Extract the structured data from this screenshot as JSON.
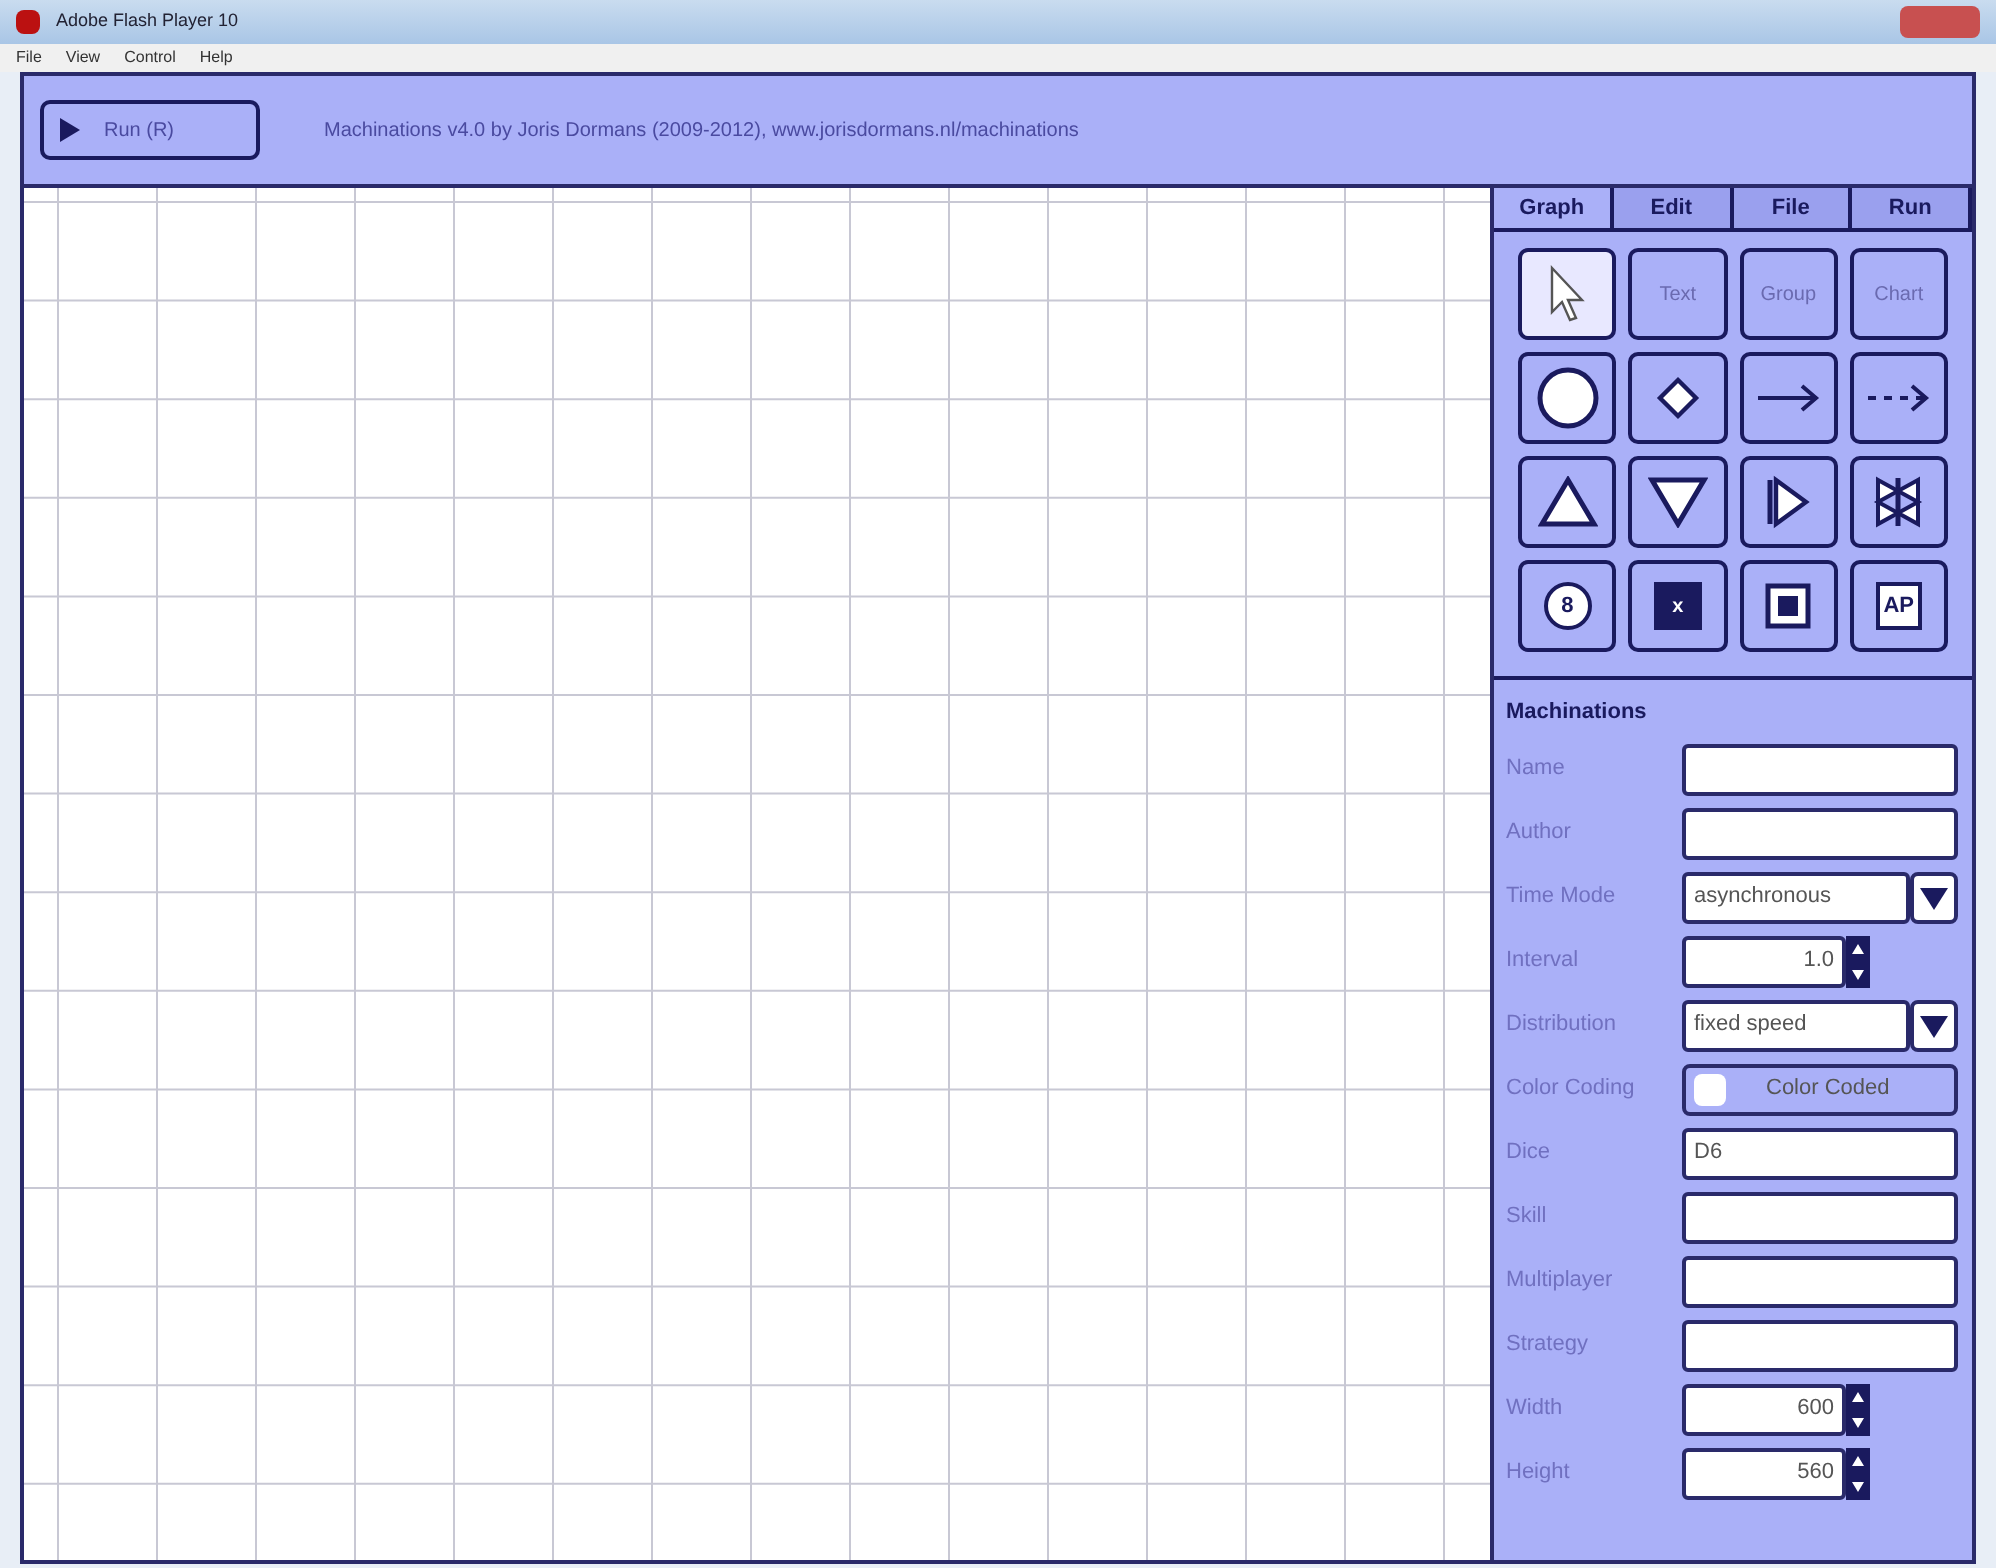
{
  "window": {
    "title": "Adobe Flash Player 10"
  },
  "menu": [
    "File",
    "View",
    "Control",
    "Help"
  ],
  "toolbar": {
    "run_button": "Run (R)",
    "caption": "Machinations v4.0 by Joris Dormans (2009-2012), www.jorisdormans.nl/machinations"
  },
  "tabs": [
    {
      "label": "Graph",
      "selected": true
    },
    {
      "label": "Edit",
      "selected": false
    },
    {
      "label": "File",
      "selected": false
    },
    {
      "label": "Run",
      "selected": false
    }
  ],
  "tools": [
    {
      "kind": "pointer",
      "selected": true
    },
    {
      "kind": "text",
      "label": "Text",
      "selected": false
    },
    {
      "kind": "text",
      "label": "Group",
      "selected": false
    },
    {
      "kind": "text",
      "label": "Chart",
      "selected": false
    },
    {
      "kind": "circle",
      "selected": false
    },
    {
      "kind": "diamond",
      "selected": false
    },
    {
      "kind": "arrow",
      "selected": false
    },
    {
      "kind": "dashed-arrow",
      "selected": false
    },
    {
      "kind": "triangle-up",
      "selected": false
    },
    {
      "kind": "triangle-down",
      "selected": false
    },
    {
      "kind": "converter",
      "selected": false
    },
    {
      "kind": "trader",
      "selected": false
    },
    {
      "kind": "badge",
      "label": "8",
      "selected": false
    },
    {
      "kind": "dark-square",
      "label": "x",
      "selected": false
    },
    {
      "kind": "framed-square",
      "selected": false
    },
    {
      "kind": "badge-box",
      "label": "AP",
      "selected": false
    }
  ],
  "properties": {
    "title": "Machinations",
    "fields": [
      {
        "label": "Name",
        "kind": "text"
      },
      {
        "label": "Author",
        "kind": "text"
      },
      {
        "label": "Time Mode",
        "kind": "select",
        "value": "asynchronous"
      },
      {
        "label": "Interval",
        "kind": "spinner",
        "value": "1.0"
      },
      {
        "label": "Distribution",
        "kind": "select",
        "value": "fixed speed"
      },
      {
        "label": "Color Coding",
        "kind": "color",
        "value": "Color Coded"
      },
      {
        "label": "Dice",
        "kind": "text",
        "value": "D6"
      },
      {
        "label": "Skill",
        "kind": "text"
      },
      {
        "label": "Multiplayer",
        "kind": "text"
      },
      {
        "label": "Strategy",
        "kind": "text"
      },
      {
        "label": "Width",
        "kind": "spinner",
        "value": "600"
      },
      {
        "label": "Height",
        "kind": "spinner",
        "value": "560"
      }
    ]
  }
}
